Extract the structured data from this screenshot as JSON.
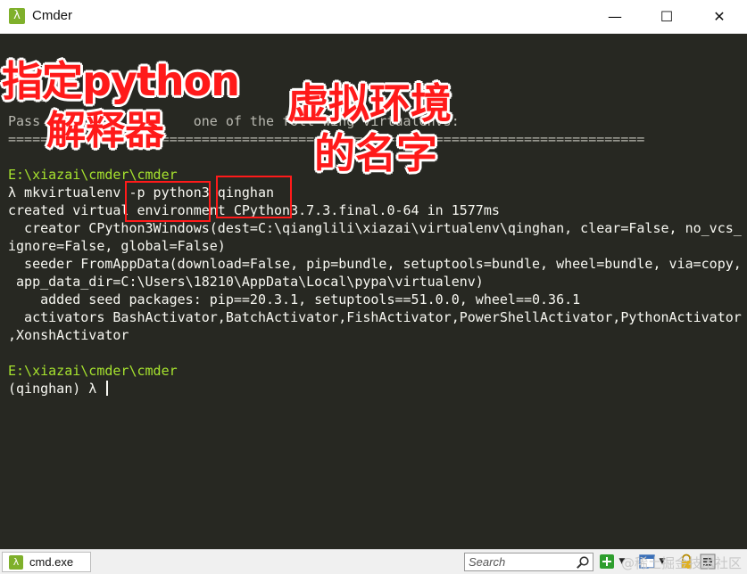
{
  "window": {
    "app_icon": "λ",
    "title": "Cmder",
    "minimize_glyph": "—",
    "maximize_glyph": "☐",
    "close_glyph": "✕"
  },
  "terminal": {
    "lines": [
      "  ing n...",
      "Pass e                 one of the foll wing virtualenvs:",
      "===============================================================================",
      "",
      "E:\\xiazai\\cmder\\cmder",
      "λ mkvirtualenv -p python3 qinghan",
      "created virtual environment CPython3.7.3.final.0-64 in 1577ms",
      "  creator CPython3Windows(dest=C:\\qianglili\\xiazai\\virtualenv\\qinghan, clear=False, no_vcs_",
      "ignore=False, global=False)",
      "  seeder FromAppData(download=False, pip=bundle, setuptools=bundle, wheel=bundle, via=copy,",
      " app_data_dir=C:\\Users\\18210\\AppData\\Local\\pypa\\virtualenv)",
      "    added seed packages: pip==20.3.1, setuptools==51.0.0, wheel==0.36.1",
      "  activators BashActivator,BatchActivator,FishActivator,PowerShellActivator,PythonActivator",
      ",XonshActivator",
      "",
      "E:\\xiazai\\cmder\\cmder",
      "(qinghan) λ "
    ]
  },
  "annotations": {
    "interpreter_line1": "指定python",
    "interpreter_line2": "解释器",
    "venv_name_line1": "虚拟环境",
    "venv_name_line2": "的名字"
  },
  "statusbar": {
    "tab_label": "cmd.exe",
    "tab_icon": "λ",
    "search_placeholder": "Search",
    "watermark": "@稀土掘金技术社区"
  },
  "colors": {
    "terminal_bg": "#272822",
    "terminal_fg": "#f8f8f2",
    "annotation_red": "#ff1a1a",
    "cmder_green": "#7fb02b"
  }
}
